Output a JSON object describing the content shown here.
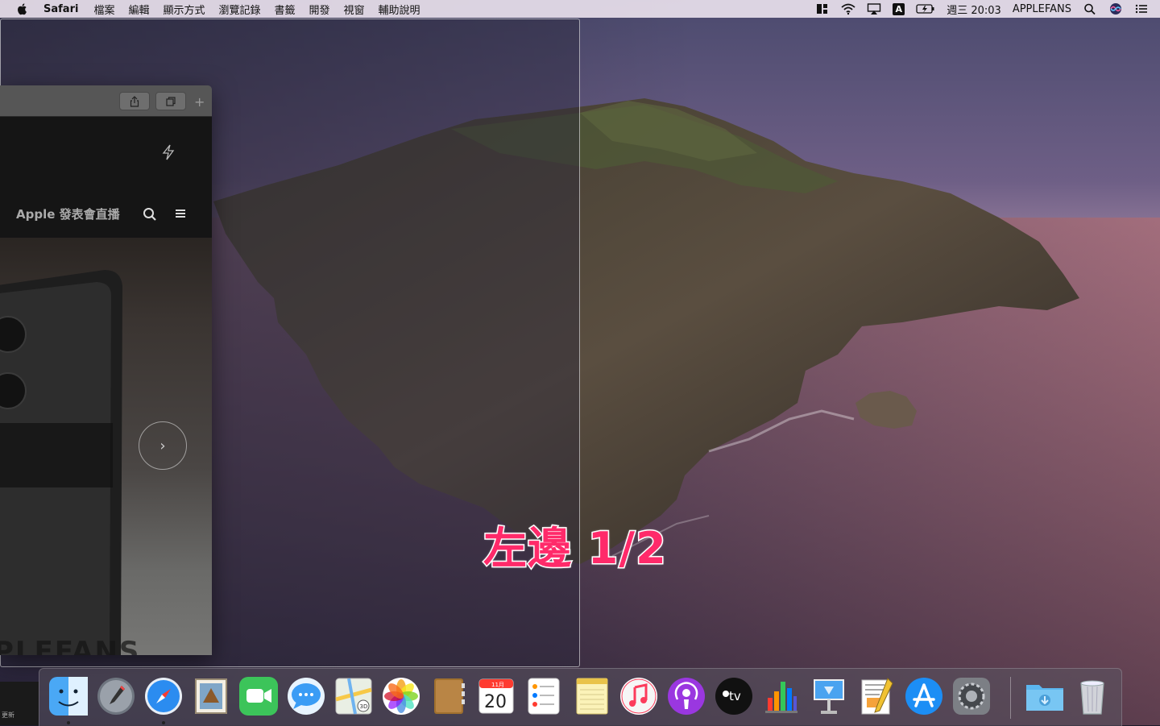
{
  "menubar": {
    "app_name": "Safari",
    "menus": [
      "檔案",
      "編輯",
      "顯示方式",
      "瀏覽記錄",
      "書籤",
      "開發",
      "視窗",
      "輔助說明"
    ],
    "input_source": "A",
    "clock": "週三 20:03",
    "user": "APPLEFANS"
  },
  "safari": {
    "site_title": "Apple 發表會直播",
    "next_glyph": "›",
    "hero_logo": "PLEFANS",
    "new_tab_glyph": "+"
  },
  "caption": "左邊 1/2",
  "dock": {
    "side_text": "更新",
    "calendar_month": "11月",
    "calendar_day": "20",
    "tv_label": "tv",
    "items": [
      {
        "name": "finder"
      },
      {
        "name": "launchpad"
      },
      {
        "name": "safari"
      },
      {
        "name": "mail"
      },
      {
        "name": "facetime"
      },
      {
        "name": "messages"
      },
      {
        "name": "maps"
      },
      {
        "name": "photos"
      },
      {
        "name": "contacts"
      },
      {
        "name": "calendar"
      },
      {
        "name": "reminders"
      },
      {
        "name": "notes"
      },
      {
        "name": "music"
      },
      {
        "name": "podcasts"
      },
      {
        "name": "apple-tv"
      },
      {
        "name": "numbers"
      },
      {
        "name": "keynote"
      },
      {
        "name": "pages"
      },
      {
        "name": "app-store"
      },
      {
        "name": "system-preferences"
      },
      {
        "name": "downloads"
      },
      {
        "name": "trash"
      }
    ]
  },
  "colors": {
    "caption": "#ff2a6a",
    "menubar": "#e8e0ec"
  }
}
